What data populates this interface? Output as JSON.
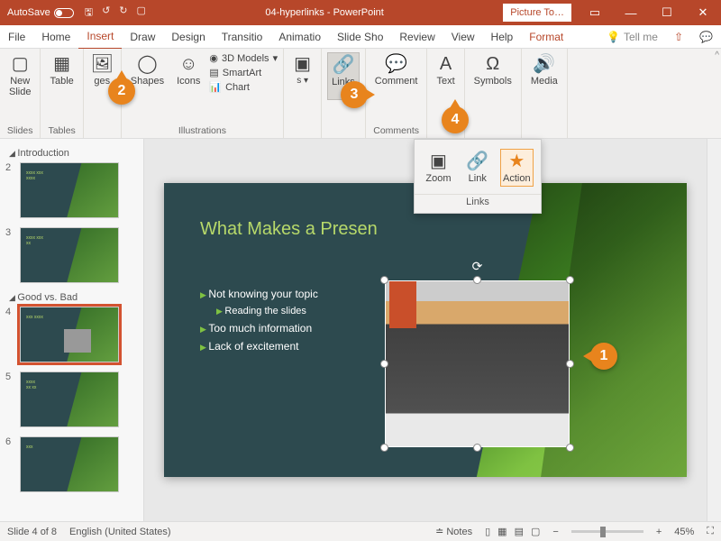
{
  "titlebar": {
    "autosave": "AutoSave",
    "doc": "04-hyperlinks - PowerPoint",
    "picture_tools": "Picture To…"
  },
  "tabs": {
    "file": "File",
    "home": "Home",
    "insert": "Insert",
    "draw": "Draw",
    "design": "Design",
    "transitions": "Transitio",
    "animations": "Animatio",
    "slideshow": "Slide Sho",
    "review": "Review",
    "view": "View",
    "help": "Help",
    "format": "Format",
    "tellme": "Tell me"
  },
  "ribbon": {
    "slides": {
      "new_slide": "New\nSlide",
      "label": "Slides"
    },
    "tables": {
      "table": "Table",
      "label": "Tables"
    },
    "images": {
      "btn": "ges",
      "label": ""
    },
    "illustrations": {
      "shapes": "Shapes",
      "icons": "Icons",
      "models": "3D Models",
      "smartart": "SmartArt",
      "chart": "Chart",
      "label": "Illustrations"
    },
    "links": {
      "links": "Links",
      "label": ""
    },
    "comments": {
      "comment": "Comment",
      "label": "Comments"
    },
    "text": {
      "text": "Text",
      "label": ""
    },
    "symbols": {
      "symbols": "Symbols",
      "label": ""
    },
    "media": {
      "media": "Media",
      "label": ""
    }
  },
  "links_dropdown": {
    "zoom": "Zoom",
    "link": "Link",
    "action": "Action",
    "label": "Links"
  },
  "callouts": {
    "c1": "1",
    "c2": "2",
    "c3": "3",
    "c4": "4"
  },
  "thumbs": {
    "section1": "Introduction",
    "section2": "Good vs. Bad",
    "s2": "2",
    "s3": "3",
    "s4": "4",
    "s5": "5",
    "s6": "6"
  },
  "slide": {
    "title": "What Makes a Presen",
    "b1": "Not knowing your topic",
    "b2": "Reading the slides",
    "b3": "Too much information",
    "b4": "Lack of excitement"
  },
  "status": {
    "slide": "Slide 4 of 8",
    "lang": "English (United States)",
    "notes": "Notes",
    "zoom": "45%"
  }
}
